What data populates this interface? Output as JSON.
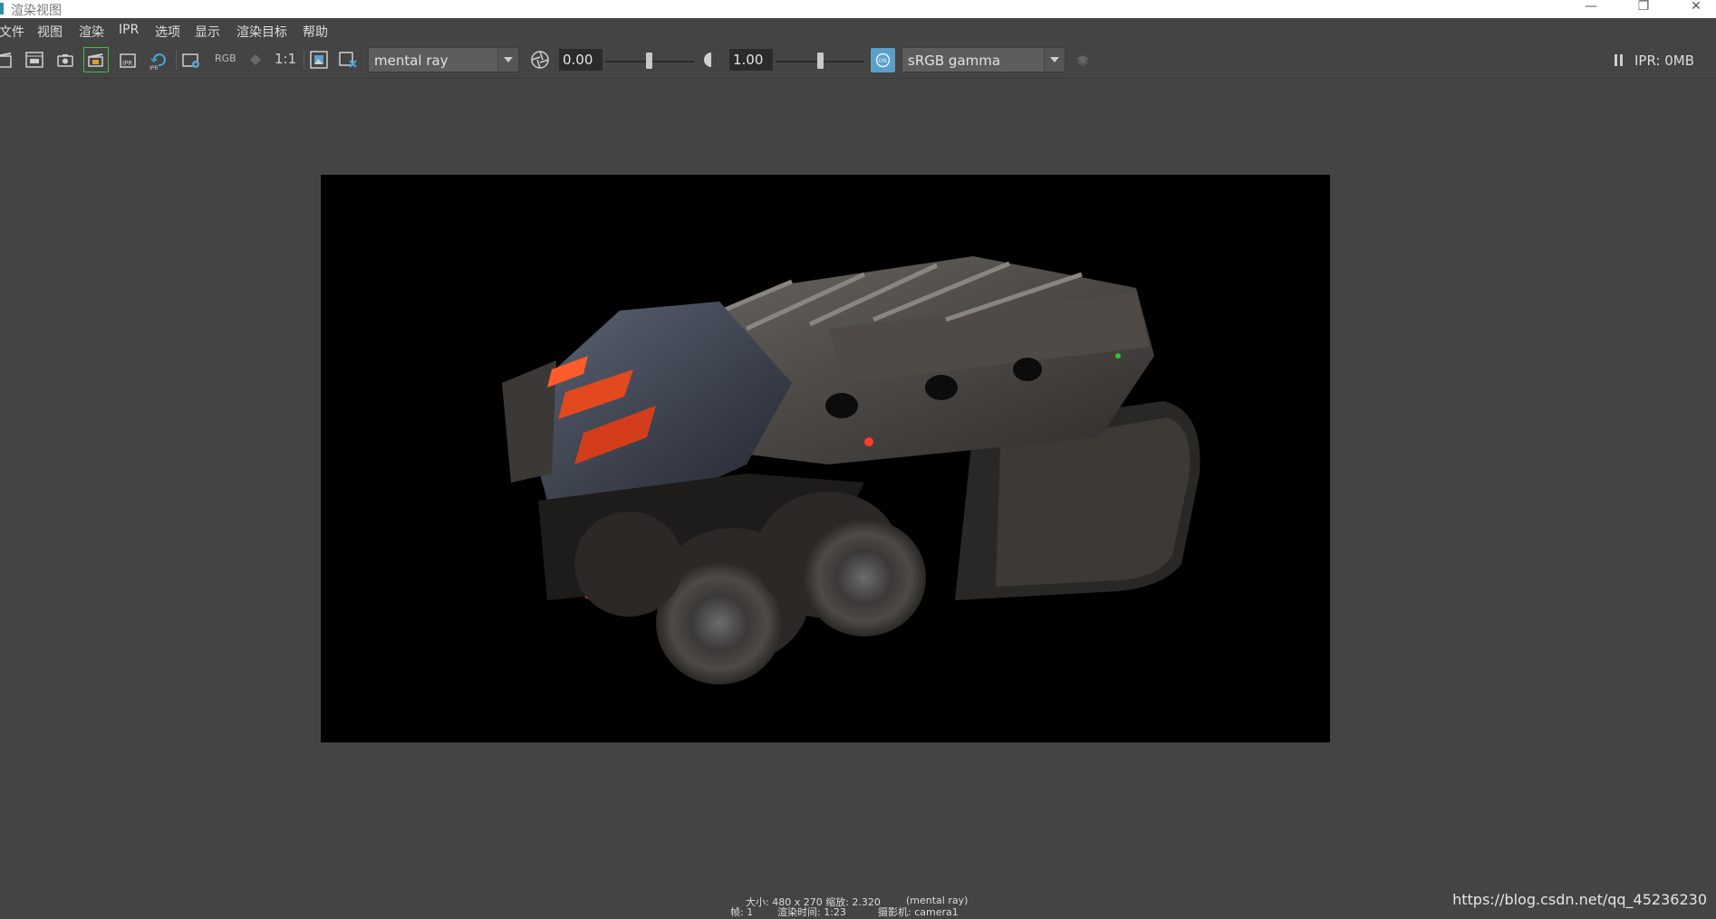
{
  "window": {
    "title": "渲染视图",
    "minimize_glyph": "—",
    "maximize_glyph": "❐",
    "close_glyph": "✕"
  },
  "menu": {
    "items": [
      "文件",
      "视图",
      "渲染",
      "IPR",
      "选项",
      "显示",
      "渲染目标",
      "帮助"
    ]
  },
  "toolbar": {
    "rgb_label": "RGB",
    "one_to_one_label": "1:1",
    "renderer": "mental ray",
    "exposure": "0.00",
    "gamma": "1.00",
    "color_space": "sRGB gamma",
    "ipr_status": "IPR: 0MB"
  },
  "footer": {
    "size_zoom": "大小: 480 x 270 缩放: 2.320",
    "renderer_note": "(mental ray)",
    "frame": "帧: 1",
    "render_time": "渲染时间: 1:23",
    "camera": "摄影机: camera1"
  },
  "watermark": "https://blog.csdn.net/qq_45236230",
  "colors": {
    "background": "#444444",
    "render_background": "#000000",
    "accent": "#2b8fa8"
  },
  "icons": [
    "clapper-icon",
    "render-region-icon",
    "snapshot-camera-icon",
    "render-sequence-icon",
    "ipr-render-icon",
    "ipr-refresh-icon",
    "render-settings-icon",
    "rgb-channels-icon",
    "alpha-channel-icon",
    "real-size-icon",
    "keep-image-icon",
    "remove-image-icon",
    "exposure-aperture-icon",
    "gamma-icon",
    "color-management-icon",
    "stack-icon",
    "pause-icon"
  ]
}
